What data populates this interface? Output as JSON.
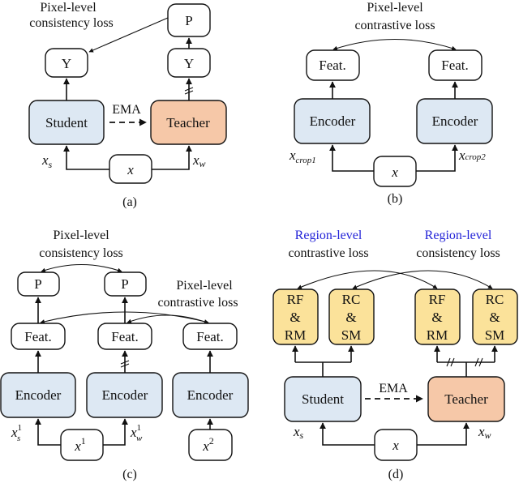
{
  "figure": {
    "panels": [
      {
        "id": "a",
        "caption": "(a)",
        "loss_label": [
          "Pixel-level",
          "consistency loss"
        ],
        "ema_label": "EMA",
        "student_label": "Student",
        "teacher_label": "Teacher",
        "y_label": "Y",
        "p_label": "P",
        "input_label": "x",
        "student_input": {
          "base": "x",
          "sub": "s"
        },
        "teacher_input": {
          "base": "x",
          "sub": "w"
        },
        "stop_gradient_mark": "//"
      },
      {
        "id": "b",
        "caption": "(b)",
        "loss_label": [
          "Pixel-level",
          "contrastive loss"
        ],
        "feat_label": "Feat.",
        "encoder_label": "Encoder",
        "input_label": "x",
        "left_input": {
          "base": "x",
          "sub": "crop1"
        },
        "right_input": {
          "base": "x",
          "sub": "crop2"
        }
      },
      {
        "id": "c",
        "caption": "(c)",
        "consistency_label": [
          "Pixel-level",
          "consistency loss"
        ],
        "contrastive_label": [
          "Pixel-level",
          "contrastive loss"
        ],
        "p_label": "P",
        "feat_label": "Feat.",
        "encoder_label": "Encoder",
        "input1": {
          "base": "x",
          "sup": "1"
        },
        "input2": {
          "base": "x",
          "sup": "2"
        },
        "left_input": {
          "base": "x",
          "sup": "1",
          "sub": "s"
        },
        "mid_input": {
          "base": "x",
          "sup": "1",
          "sub": "w"
        },
        "stop_gradient_mark": "//"
      },
      {
        "id": "d",
        "caption": "(d)",
        "contrastive_label": [
          "Region-level",
          "contrastive loss"
        ],
        "consistency_label": [
          "Region-level",
          "consistency loss"
        ],
        "ema_label": "EMA",
        "student_label": "Student",
        "teacher_label": "Teacher",
        "head_rf": [
          "RF",
          "&",
          "RM"
        ],
        "head_rc": [
          "RC",
          "&",
          "SM"
        ],
        "input_label": "x",
        "student_input": {
          "base": "x",
          "sub": "s"
        },
        "teacher_input": {
          "base": "x",
          "sub": "w"
        },
        "stop_gradient_mark": "//"
      }
    ],
    "colors": {
      "student_encoder_fill": "#dde8f3",
      "teacher_fill": "#f6c8a8",
      "head_fill": "#fbe29a",
      "region_label_color": "#2323d8",
      "line_color": "#111111"
    }
  }
}
